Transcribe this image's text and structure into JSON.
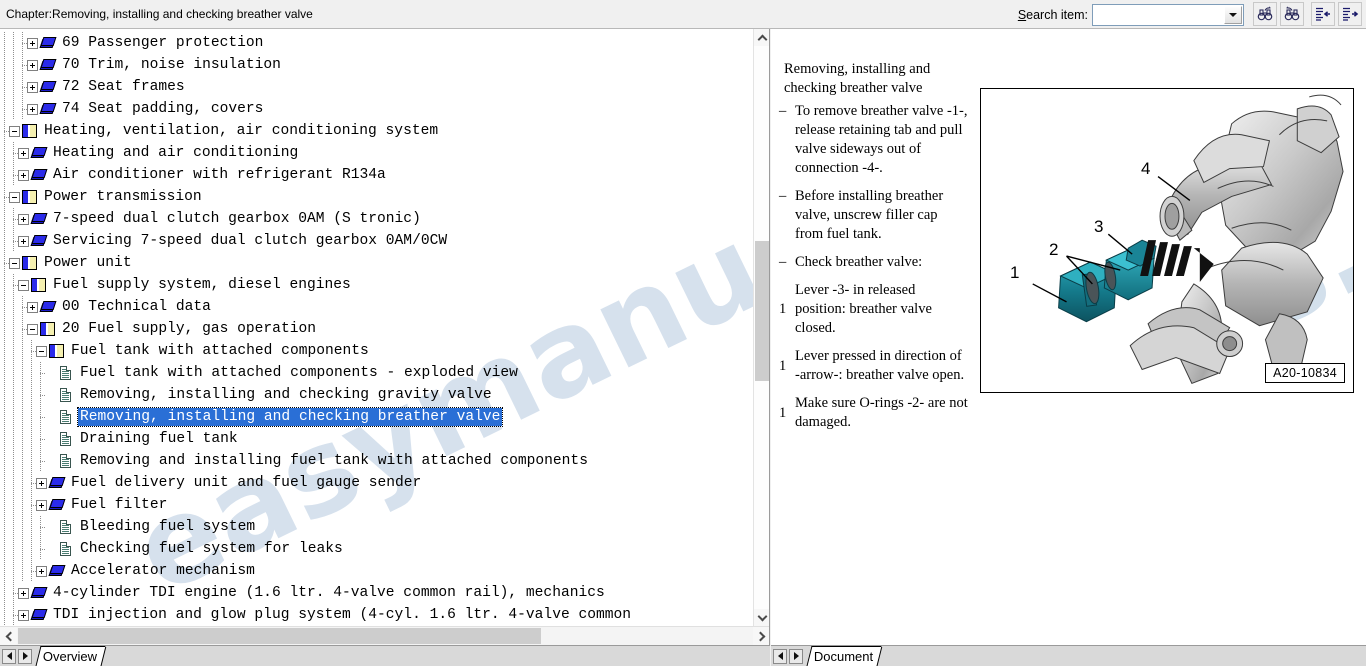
{
  "window": {
    "chapter_label": "Chapter:Removing, installing and checking breather valve"
  },
  "toolbar": {
    "search_label_prefix": "S",
    "search_label_rest": "earch item:",
    "search_value": "",
    "search_placeholder": "",
    "dropdown_icon": "chevron-down-icon",
    "buttons": [
      {
        "name": "search-previous-button",
        "icon": "binoculars-up-icon"
      },
      {
        "name": "search-next-button",
        "icon": "binoculars-down-icon"
      },
      {
        "name": "collapse-to-previous-button",
        "icon": "list-arrow-left-icon"
      },
      {
        "name": "expand-to-next-button",
        "icon": "list-arrow-right-icon"
      }
    ]
  },
  "tree": {
    "watermark": "easymanuals",
    "items": [
      {
        "indent": 3,
        "state": "collapsed",
        "icon": "closed-book-icon",
        "label": "69 Passenger protection",
        "selected": false
      },
      {
        "indent": 3,
        "state": "collapsed",
        "icon": "closed-book-icon",
        "label": "70 Trim, noise insulation",
        "selected": false
      },
      {
        "indent": 3,
        "state": "collapsed",
        "icon": "closed-book-icon",
        "label": "72 Seat frames",
        "selected": false
      },
      {
        "indent": 3,
        "state": "collapsed",
        "icon": "closed-book-icon",
        "label": "74 Seat padding, covers",
        "selected": false
      },
      {
        "indent": 1,
        "state": "expanded",
        "icon": "open-book-icon",
        "label": "Heating, ventilation, air conditioning system",
        "selected": false
      },
      {
        "indent": 2,
        "state": "collapsed",
        "icon": "closed-book-icon",
        "label": "Heating and air conditioning",
        "selected": false
      },
      {
        "indent": 2,
        "state": "collapsed",
        "icon": "closed-book-icon",
        "label": "Air conditioner with refrigerant R134a",
        "selected": false
      },
      {
        "indent": 1,
        "state": "expanded",
        "icon": "open-book-icon",
        "label": "Power transmission",
        "selected": false
      },
      {
        "indent": 2,
        "state": "collapsed",
        "icon": "closed-book-icon",
        "label": "7-speed dual clutch gearbox 0AM (S tronic)",
        "selected": false
      },
      {
        "indent": 2,
        "state": "collapsed",
        "icon": "closed-book-icon",
        "label": "Servicing 7-speed dual clutch gearbox 0AM/0CW",
        "selected": false
      },
      {
        "indent": 1,
        "state": "expanded",
        "icon": "open-book-icon",
        "label": "Power unit",
        "selected": false
      },
      {
        "indent": 2,
        "state": "expanded",
        "icon": "open-book-icon",
        "label": "Fuel supply system, diesel engines",
        "selected": false
      },
      {
        "indent": 3,
        "state": "collapsed",
        "icon": "closed-book-icon",
        "label": "00 Technical data",
        "selected": false
      },
      {
        "indent": 3,
        "state": "expanded",
        "icon": "open-book-icon",
        "label": "20 Fuel supply, gas operation",
        "selected": false
      },
      {
        "indent": 4,
        "state": "expanded",
        "icon": "open-book-icon",
        "label": "Fuel tank with attached components",
        "selected": false
      },
      {
        "indent": 5,
        "state": "leaf",
        "icon": "document-icon",
        "label": "Fuel tank with attached components - exploded view",
        "selected": false
      },
      {
        "indent": 5,
        "state": "leaf",
        "icon": "document-icon",
        "label": "Removing, installing and checking gravity valve",
        "selected": false
      },
      {
        "indent": 5,
        "state": "leaf",
        "icon": "document-icon",
        "label": "Removing, installing and checking breather valve",
        "selected": true
      },
      {
        "indent": 5,
        "state": "leaf",
        "icon": "document-icon",
        "label": "Draining fuel tank",
        "selected": false
      },
      {
        "indent": 5,
        "state": "leaf",
        "icon": "document-icon",
        "label": "Removing and installing fuel tank with attached components",
        "selected": false
      },
      {
        "indent": 4,
        "state": "collapsed",
        "icon": "closed-book-icon",
        "label": "Fuel delivery unit and fuel gauge sender",
        "selected": false
      },
      {
        "indent": 4,
        "state": "collapsed",
        "icon": "closed-book-icon",
        "label": "Fuel filter",
        "selected": false
      },
      {
        "indent": 5,
        "state": "leaf",
        "icon": "document-icon",
        "label": "Bleeding fuel system",
        "selected": false
      },
      {
        "indent": 5,
        "state": "leaf",
        "icon": "document-icon",
        "label": "Checking fuel system for leaks",
        "selected": false
      },
      {
        "indent": 4,
        "state": "collapsed",
        "icon": "closed-book-icon",
        "label": "Accelerator mechanism",
        "selected": false
      },
      {
        "indent": 2,
        "state": "collapsed",
        "icon": "closed-book-icon",
        "label": "4-cylinder TDI engine (1.6 ltr. 4-valve common rail), mechanics",
        "selected": false
      },
      {
        "indent": 2,
        "state": "collapsed",
        "icon": "closed-book-icon",
        "label": "TDI injection and glow plug system (4-cyl. 1.6 ltr. 4-valve common",
        "selected": false
      }
    ]
  },
  "document": {
    "title": "Removing, installing and checking breather valve",
    "watermark": "s.co.uk",
    "items": [
      {
        "marker": "–",
        "text": "To remove breather valve -1-, release retaining tab and pull valve sideways out of connection -4-."
      },
      {
        "marker": "–",
        "text": "Before installing breather valve, unscrew filler cap from fuel tank."
      },
      {
        "marker": "–",
        "text": "Check breather valve:"
      },
      {
        "marker": "1",
        "text": "Lever -3- in released position: breather valve closed."
      },
      {
        "marker": "1",
        "text": "Lever pressed in direction of -arrow-: breather valve open."
      },
      {
        "marker": "1",
        "text": "Make sure O-rings -2- are not damaged."
      }
    ],
    "figure": {
      "id_label": "A20-10834",
      "callouts": [
        "1",
        "2",
        "3",
        "4"
      ],
      "alt": "exploded view of breather valve and engine connection"
    }
  },
  "status": {
    "left_tab": "Overview",
    "right_tab": "Document",
    "prev_icon": "triangle-left-icon",
    "next_icon": "triangle-right-icon"
  },
  "colors": {
    "selection": "#2a6fd6",
    "watermark": "#cfdcea",
    "part_teal": "#1a7f8e",
    "chrome": "#f0f0f0"
  }
}
